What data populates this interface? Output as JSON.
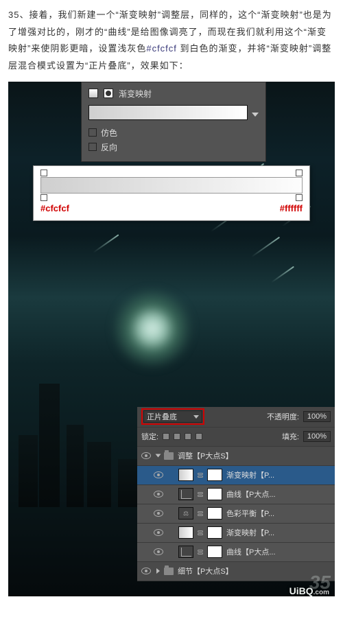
{
  "instruction": {
    "text_a": "35、接着，我们新建一个“渐变映射”调整层，同样的，这个“渐变映射”也是为了增强对比的，刚才的“曲线”是给图像调亮了，而现在我们就利用这个“渐变映射”来使阴影更暗，设置浅灰色",
    "code": "#cfcfcf",
    "text_b": " 到白色的渐变，并将“渐变映射”调整层混合模式设置为“正片叠底”，效果如下："
  },
  "panel1": {
    "title": "渐变映射",
    "cb1": "仿色",
    "cb2": "反向"
  },
  "panel2": {
    "hex_left": "#cfcfcf",
    "hex_right": "#ffffff"
  },
  "layers": {
    "blend_mode": "正片叠底",
    "opacity_label": "不透明度:",
    "opacity_value": "100%",
    "lock_label": "锁定:",
    "fill_label": "填充:",
    "fill_value": "100%",
    "group1": "调整【P大点S】",
    "items": [
      {
        "name": "渐变映射【P..."
      },
      {
        "name": "曲线【P大点..."
      },
      {
        "name": "色彩平衡【P..."
      },
      {
        "name": "渐变映射【P..."
      },
      {
        "name": "曲线【P大点..."
      }
    ],
    "group2": "细节【P大点S】"
  },
  "step_num": "35",
  "watermark": "UiBQ",
  "watermark_ext": ".com"
}
